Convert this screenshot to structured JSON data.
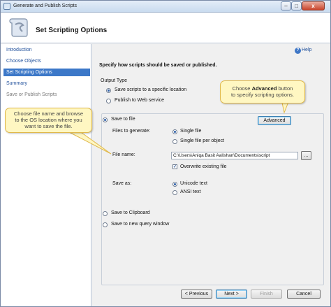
{
  "window": {
    "title": "Generate and Publish Scripts",
    "min_symbol": "–",
    "max_symbol": "□",
    "close_symbol": "x"
  },
  "header": {
    "title": "Set Scripting Options"
  },
  "sidebar": {
    "items": [
      {
        "label": "Introduction",
        "state": "link"
      },
      {
        "label": "Choose Objects",
        "state": "link"
      },
      {
        "label": "Set Scripting Options",
        "state": "active"
      },
      {
        "label": "Summary",
        "state": "link"
      },
      {
        "label": "Save or Publish Scripts",
        "state": "disabled"
      }
    ]
  },
  "help": {
    "label": "Help",
    "icon_glyph": "?"
  },
  "main": {
    "instruction": "Specify how scripts should be saved or published.",
    "output_type": {
      "legend": "Output Type",
      "save_scripts": "Save scripts to a specific location",
      "publish_web": "Publish to Web service"
    },
    "save_to_file": {
      "label": "Save to file",
      "files_to_generate_label": "Files to generate:",
      "single_file": "Single file",
      "single_file_per_object": "Single file per object",
      "file_name_label": "File name:",
      "file_name_value": "C:\\Users\\Aniqa Basit Aalishan\\Documents\\script",
      "browse_label": "...",
      "overwrite_label": "Overwrite existing file",
      "overwrite_check": "✓",
      "save_as_label": "Save as:",
      "unicode_text": "Unicode text",
      "ansi_text": "ANSI text",
      "advanced_label": "Advanced"
    },
    "save_to_clipboard": "Save to Clipboard",
    "save_to_query_window": "Save to new query window"
  },
  "footer": {
    "previous_label": "< Previous",
    "next_label": "Next >",
    "finish_label": "Finish",
    "cancel_label": "Cancel"
  },
  "callouts": {
    "advanced_pre": "Choose ",
    "advanced_bold": "Advanced",
    "advanced_post": " button",
    "advanced_line2": "to specify scripting options.",
    "file_line1": "Choose file name and browse",
    "file_line2": "to the OS location where you",
    "file_line3": "want to save the file."
  },
  "colors": {
    "accent": "#3c78c8",
    "callout_bg": "#fff7c2",
    "callout_border": "#e0b84a"
  }
}
